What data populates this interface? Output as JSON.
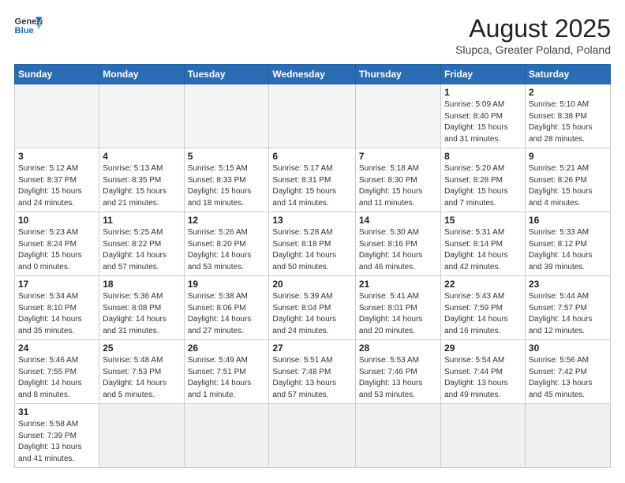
{
  "header": {
    "logo_line1": "General",
    "logo_line2": "Blue",
    "title": "August 2025",
    "subtitle": "Slupca, Greater Poland, Poland"
  },
  "weekdays": [
    "Sunday",
    "Monday",
    "Tuesday",
    "Wednesday",
    "Thursday",
    "Friday",
    "Saturday"
  ],
  "rows": [
    [
      {
        "day": "",
        "info": ""
      },
      {
        "day": "",
        "info": ""
      },
      {
        "day": "",
        "info": ""
      },
      {
        "day": "",
        "info": ""
      },
      {
        "day": "",
        "info": ""
      },
      {
        "day": "1",
        "info": "Sunrise: 5:09 AM\nSunset: 8:40 PM\nDaylight: 15 hours\nand 31 minutes."
      },
      {
        "day": "2",
        "info": "Sunrise: 5:10 AM\nSunset: 8:38 PM\nDaylight: 15 hours\nand 28 minutes."
      }
    ],
    [
      {
        "day": "3",
        "info": "Sunrise: 5:12 AM\nSunset: 8:37 PM\nDaylight: 15 hours\nand 24 minutes."
      },
      {
        "day": "4",
        "info": "Sunrise: 5:13 AM\nSunset: 8:35 PM\nDaylight: 15 hours\nand 21 minutes."
      },
      {
        "day": "5",
        "info": "Sunrise: 5:15 AM\nSunset: 8:33 PM\nDaylight: 15 hours\nand 18 minutes."
      },
      {
        "day": "6",
        "info": "Sunrise: 5:17 AM\nSunset: 8:31 PM\nDaylight: 15 hours\nand 14 minutes."
      },
      {
        "day": "7",
        "info": "Sunrise: 5:18 AM\nSunset: 8:30 PM\nDaylight: 15 hours\nand 11 minutes."
      },
      {
        "day": "8",
        "info": "Sunrise: 5:20 AM\nSunset: 8:28 PM\nDaylight: 15 hours\nand 7 minutes."
      },
      {
        "day": "9",
        "info": "Sunrise: 5:21 AM\nSunset: 8:26 PM\nDaylight: 15 hours\nand 4 minutes."
      }
    ],
    [
      {
        "day": "10",
        "info": "Sunrise: 5:23 AM\nSunset: 8:24 PM\nDaylight: 15 hours\nand 0 minutes."
      },
      {
        "day": "11",
        "info": "Sunrise: 5:25 AM\nSunset: 8:22 PM\nDaylight: 14 hours\nand 57 minutes."
      },
      {
        "day": "12",
        "info": "Sunrise: 5:26 AM\nSunset: 8:20 PM\nDaylight: 14 hours\nand 53 minutes."
      },
      {
        "day": "13",
        "info": "Sunrise: 5:28 AM\nSunset: 8:18 PM\nDaylight: 14 hours\nand 50 minutes."
      },
      {
        "day": "14",
        "info": "Sunrise: 5:30 AM\nSunset: 8:16 PM\nDaylight: 14 hours\nand 46 minutes."
      },
      {
        "day": "15",
        "info": "Sunrise: 5:31 AM\nSunset: 8:14 PM\nDaylight: 14 hours\nand 42 minutes."
      },
      {
        "day": "16",
        "info": "Sunrise: 5:33 AM\nSunset: 8:12 PM\nDaylight: 14 hours\nand 39 minutes."
      }
    ],
    [
      {
        "day": "17",
        "info": "Sunrise: 5:34 AM\nSunset: 8:10 PM\nDaylight: 14 hours\nand 35 minutes."
      },
      {
        "day": "18",
        "info": "Sunrise: 5:36 AM\nSunset: 8:08 PM\nDaylight: 14 hours\nand 31 minutes."
      },
      {
        "day": "19",
        "info": "Sunrise: 5:38 AM\nSunset: 8:06 PM\nDaylight: 14 hours\nand 27 minutes."
      },
      {
        "day": "20",
        "info": "Sunrise: 5:39 AM\nSunset: 8:04 PM\nDaylight: 14 hours\nand 24 minutes."
      },
      {
        "day": "21",
        "info": "Sunrise: 5:41 AM\nSunset: 8:01 PM\nDaylight: 14 hours\nand 20 minutes."
      },
      {
        "day": "22",
        "info": "Sunrise: 5:43 AM\nSunset: 7:59 PM\nDaylight: 14 hours\nand 16 minutes."
      },
      {
        "day": "23",
        "info": "Sunrise: 5:44 AM\nSunset: 7:57 PM\nDaylight: 14 hours\nand 12 minutes."
      }
    ],
    [
      {
        "day": "24",
        "info": "Sunrise: 5:46 AM\nSunset: 7:55 PM\nDaylight: 14 hours\nand 8 minutes."
      },
      {
        "day": "25",
        "info": "Sunrise: 5:48 AM\nSunset: 7:53 PM\nDaylight: 14 hours\nand 5 minutes."
      },
      {
        "day": "26",
        "info": "Sunrise: 5:49 AM\nSunset: 7:51 PM\nDaylight: 14 hours\nand 1 minute."
      },
      {
        "day": "27",
        "info": "Sunrise: 5:51 AM\nSunset: 7:48 PM\nDaylight: 13 hours\nand 57 minutes."
      },
      {
        "day": "28",
        "info": "Sunrise: 5:53 AM\nSunset: 7:46 PM\nDaylight: 13 hours\nand 53 minutes."
      },
      {
        "day": "29",
        "info": "Sunrise: 5:54 AM\nSunset: 7:44 PM\nDaylight: 13 hours\nand 49 minutes."
      },
      {
        "day": "30",
        "info": "Sunrise: 5:56 AM\nSunset: 7:42 PM\nDaylight: 13 hours\nand 45 minutes."
      }
    ],
    [
      {
        "day": "31",
        "info": "Sunrise: 5:58 AM\nSunset: 7:39 PM\nDaylight: 13 hours\nand 41 minutes."
      },
      {
        "day": "",
        "info": ""
      },
      {
        "day": "",
        "info": ""
      },
      {
        "day": "",
        "info": ""
      },
      {
        "day": "",
        "info": ""
      },
      {
        "day": "",
        "info": ""
      },
      {
        "day": "",
        "info": ""
      }
    ]
  ]
}
